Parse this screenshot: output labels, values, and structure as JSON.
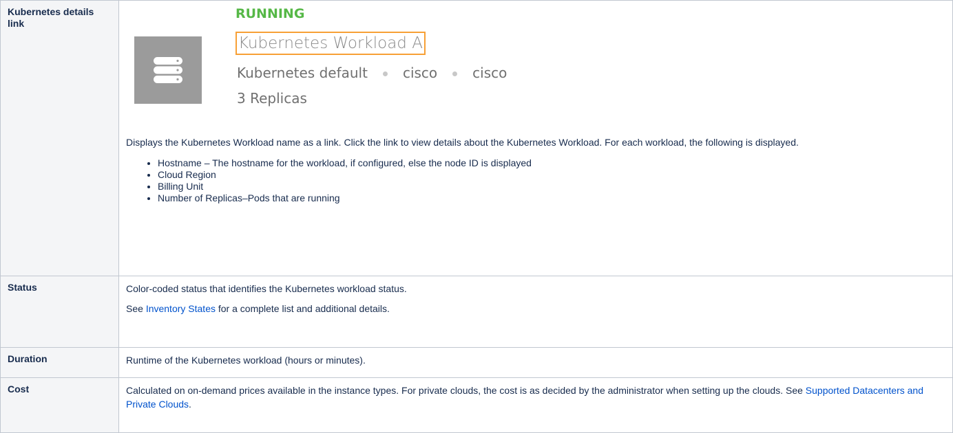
{
  "rows": [
    {
      "key": "Kubernetes details link",
      "card": {
        "status": "RUNNING",
        "status_color": "#56b847",
        "icon": "server-stack-icon",
        "workload_name": "Kubernetes Workload A",
        "cloud": "Kubernetes default",
        "account": "cisco",
        "owner": "cisco",
        "replicas": "3 Replicas"
      },
      "description": "Displays the Kubernetes Workload name as a link. Click the link to view details about the Kubernetes Workload. For each workload, the following is displayed.",
      "bullets": [
        "Hostname – The hostname for the workload, if configured, else the node ID is displayed",
        "Cloud Region",
        "Billing Unit",
        "Number of Replicas–Pods that are running"
      ]
    },
    {
      "key": "Status",
      "text": "Color-coded status that identifies the Kubernetes workload status.",
      "see_prefix": "See ",
      "link": "Inventory States",
      "see_suffix": " for a complete list and additional details."
    },
    {
      "key": "Duration",
      "text": "Runtime of the Kubernetes workload (hours or minutes)."
    },
    {
      "key": "Cost",
      "text": "Calculated on on-demand prices available in the instance types. For private clouds, the cost is as decided by the administrator when setting up the clouds. See ",
      "link": "Supported Datacenters and Private Clouds",
      "suffix": "."
    }
  ],
  "colors": {
    "link": "#0052cc",
    "highlight_border": "#f7a035"
  }
}
